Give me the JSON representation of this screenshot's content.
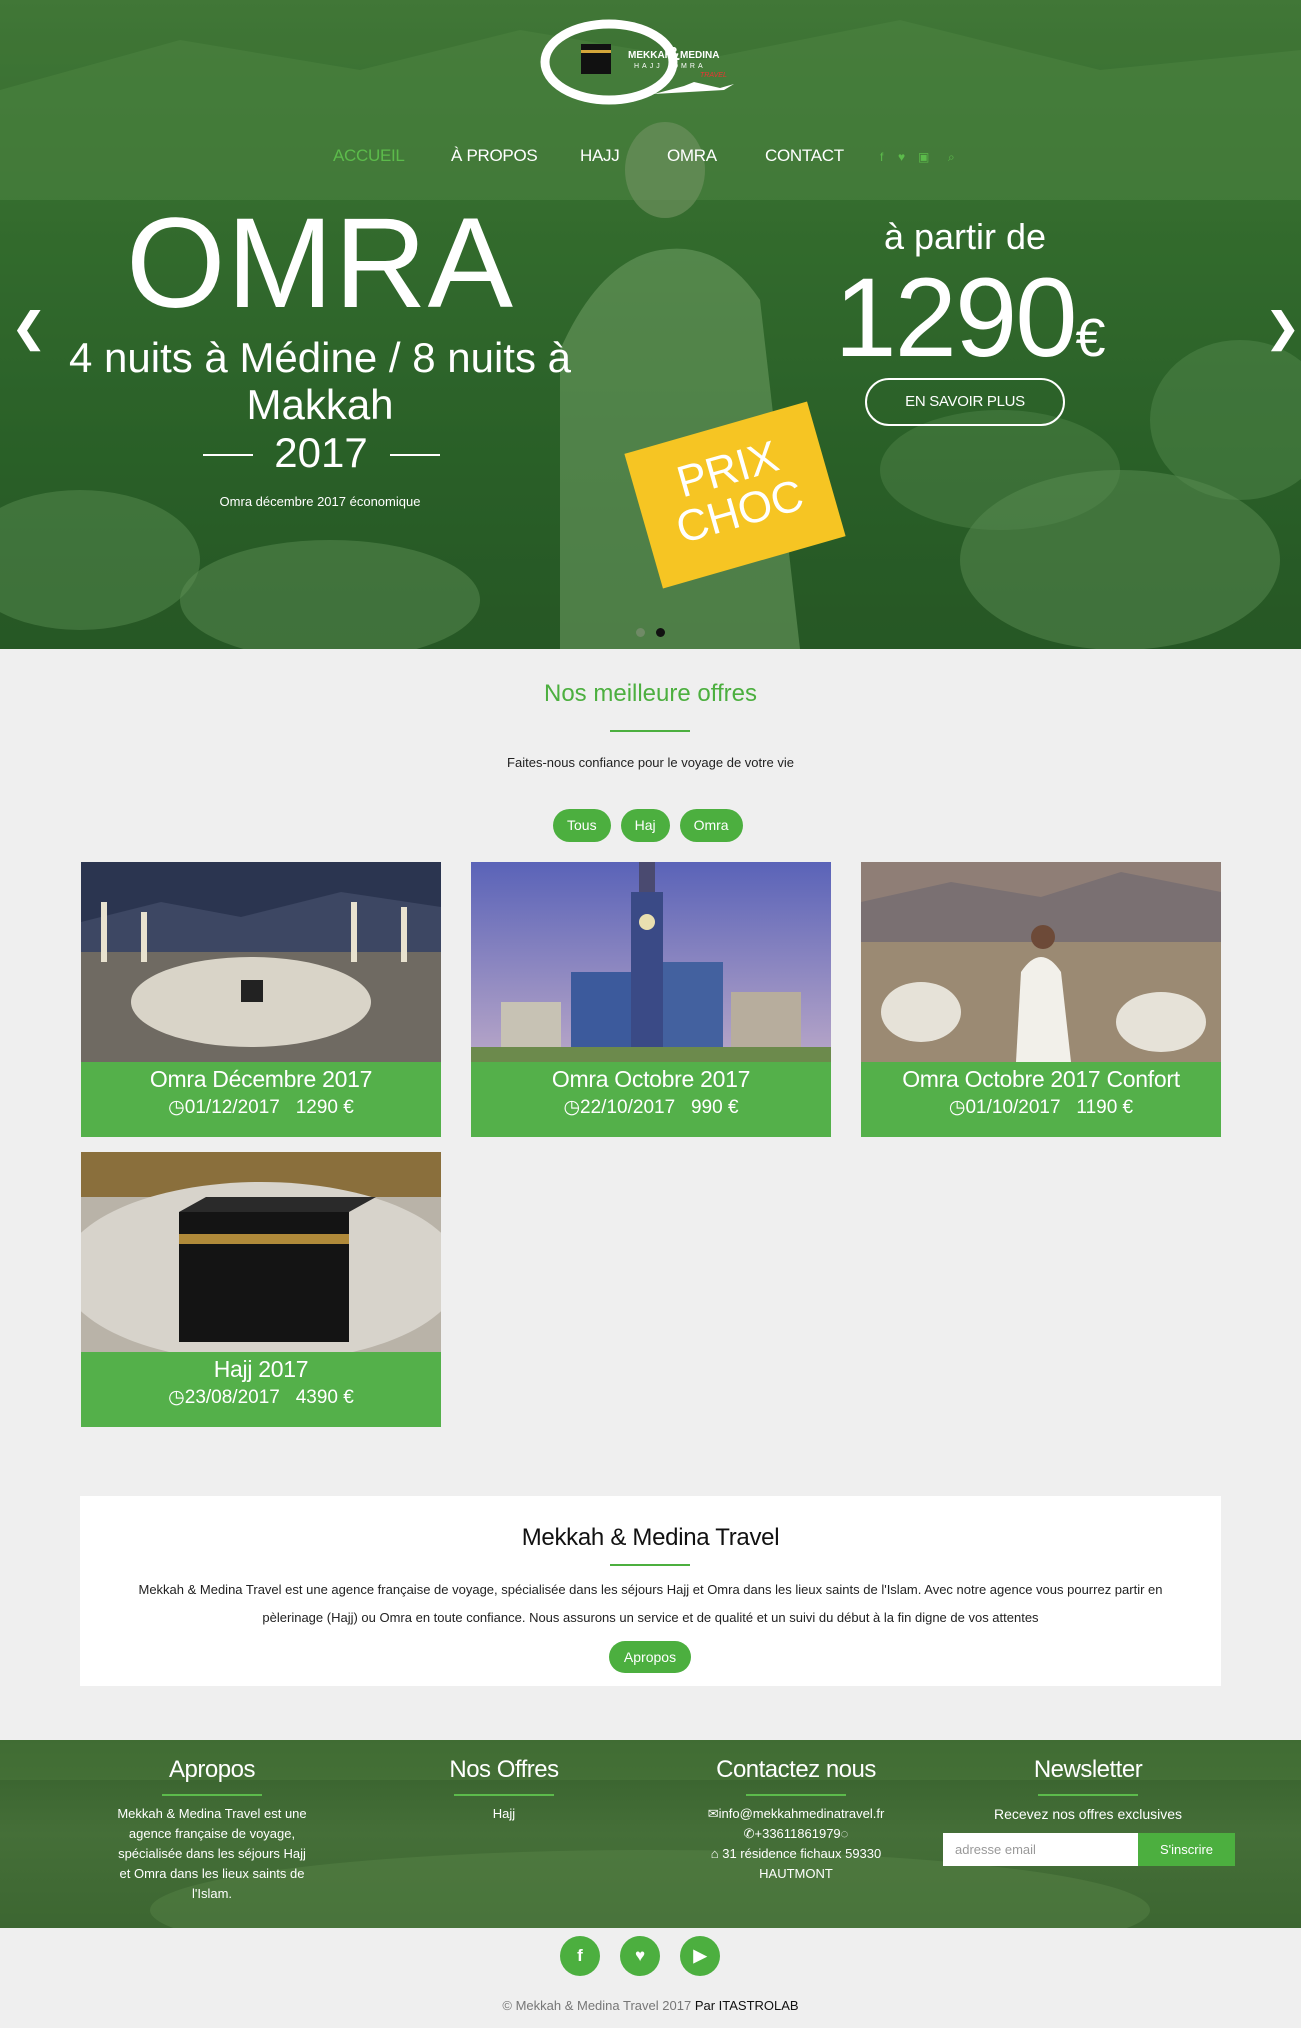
{
  "brand": {
    "name_line1": "MEKKAH",
    "amp": "&",
    "name_line2": "MEDINA",
    "sub": "HAJJ  OMRA",
    "travel": "TRAVEL"
  },
  "nav": {
    "items": [
      "ACCUEIL",
      "À PROPOS",
      "HAJJ",
      "OMRA",
      "CONTACT"
    ],
    "active": "ACCUEIL"
  },
  "hero": {
    "title": "OMRA",
    "subtitle": "4 nuits à Médine / 8 nuits à Makkah",
    "year": "2017",
    "caption": "Omra décembre 2017 économique",
    "from_label": "à partir de",
    "price": "1290",
    "currency": "€",
    "cta": "EN SAVOIR PLUS",
    "badge_line1": "PRIX",
    "badge_line2": "CHOC",
    "prev": "❮",
    "next": "❯"
  },
  "offers": {
    "title": "Nos meilleure offres",
    "subtitle": "Faites-nous confiance pour le voyage de votre vie",
    "filters": [
      "Tous",
      "Haj",
      "Omra"
    ],
    "cards": [
      {
        "title": "Omra Décembre 2017",
        "date": "01/12/2017",
        "price": "1290 €"
      },
      {
        "title": "Omra Octobre 2017",
        "date": "22/10/2017",
        "price": "990 €"
      },
      {
        "title": "Omra Octobre 2017 Confort",
        "date": "01/10/2017",
        "price": "1190 €"
      },
      {
        "title": "Hajj 2017",
        "date": "23/08/2017",
        "price": "4390 €"
      }
    ]
  },
  "about": {
    "title": "Mekkah & Medina Travel",
    "text": "Mekkah & Medina Travel est une agence française de voyage, spécialisée dans les séjours Hajj et Omra dans les lieux saints de l'Islam. Avec notre agence vous pourrez partir en pèlerinage (Hajj) ou Omra en toute confiance. Nous assurons un service et de qualité et un suivi du début à la fin digne de vos attentes",
    "button": "Apropos"
  },
  "footer": {
    "apropos_title": "Apropos",
    "apropos_text": "Mekkah & Medina Travel est une agence française de voyage, spécialisée dans les séjours Hajj et Omra dans les lieux saints de l'Islam.",
    "offres_title": "Nos Offres",
    "offres_item": "Hajj",
    "contact_title": "Contactez nous",
    "email": "info@mekkahmedinatravel.fr",
    "phone": "+33611861979",
    "address_line1": "31 résidence fichaux 59330",
    "address_line2": "HAUTMONT",
    "news_title": "Newsletter",
    "news_text": "Recevez nos offres exclusives",
    "news_placeholder": "adresse email",
    "news_button": "S'inscrire"
  },
  "copyright": {
    "text": "© Mekkah & Medina Travel 2017",
    "by": "Par ITASTROLAB"
  },
  "colors": {
    "accent": "#4caf3f",
    "badge": "#f6c523"
  }
}
